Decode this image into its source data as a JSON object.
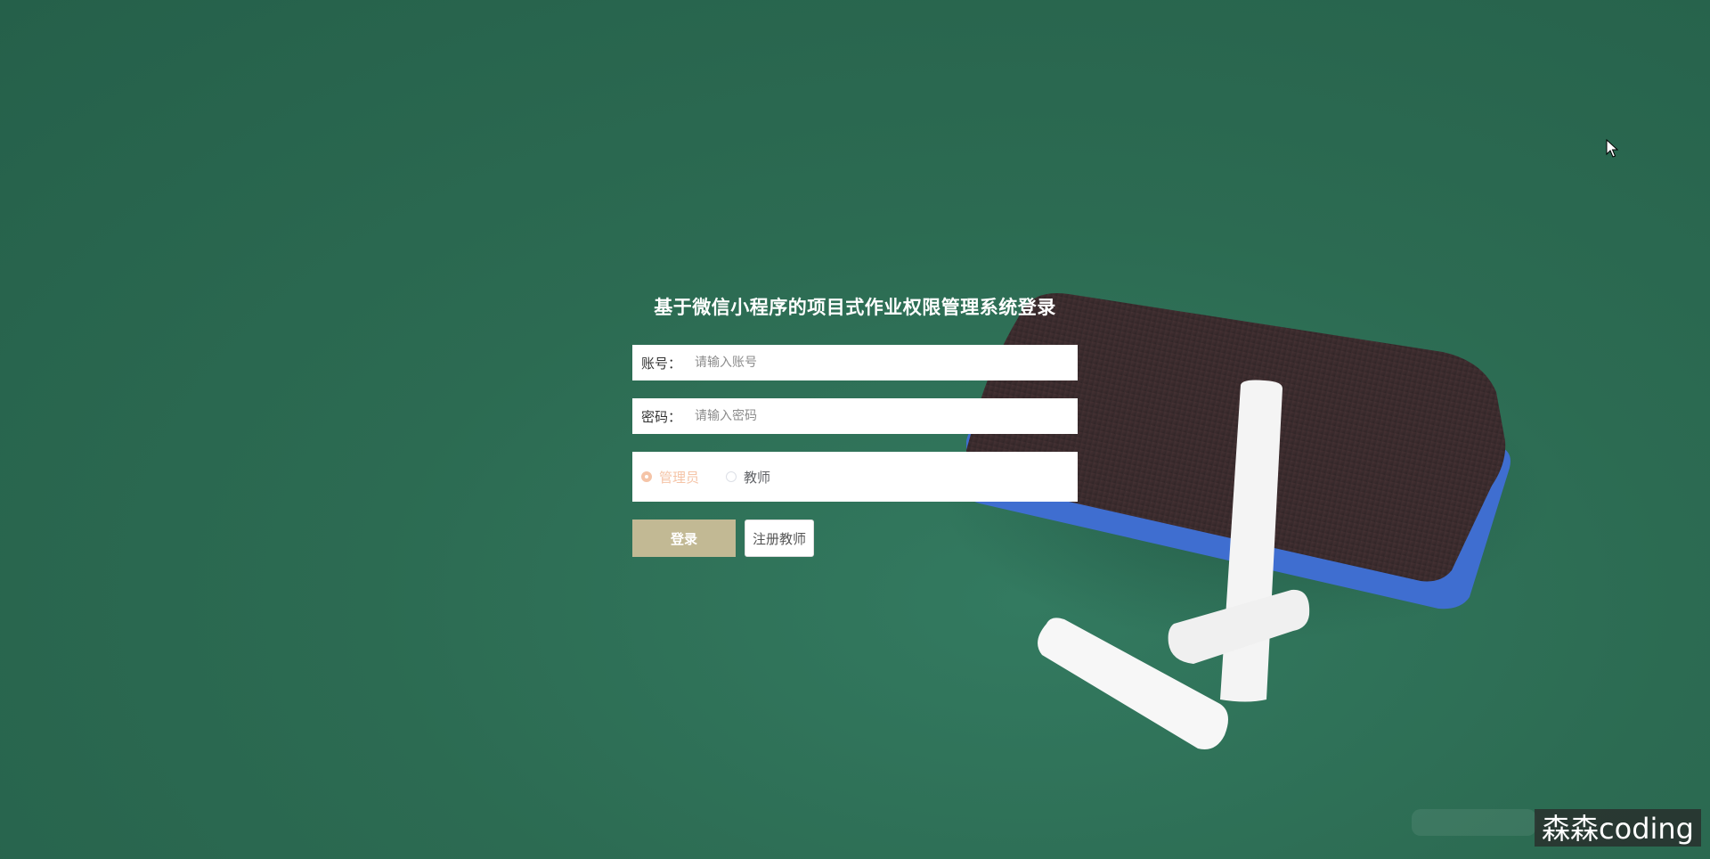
{
  "page": {
    "title": "基于微信小程序的项目式作业权限管理系统登录"
  },
  "form": {
    "account": {
      "label": "账号：",
      "placeholder": "请输入账号",
      "value": ""
    },
    "password": {
      "label": "密码：",
      "placeholder": "请输入密码",
      "value": ""
    },
    "roles": [
      {
        "label": "管理员",
        "checked": true
      },
      {
        "label": "教师",
        "checked": false
      }
    ],
    "login_label": "登录",
    "register_label": "注册教师"
  },
  "watermark": "森森coding",
  "colors": {
    "background": "#2c6b52",
    "login_button": "#c2b994",
    "role_selected": "#f5c4a7"
  },
  "icons": {
    "background_decoration": "chalkboard-eraser-and-chalk",
    "cursor": "mouse-pointer-icon"
  }
}
